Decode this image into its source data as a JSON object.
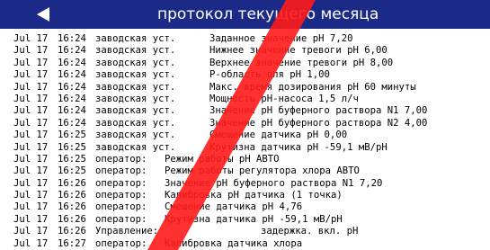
{
  "header": {
    "title": "протокол текущего месяца",
    "back_icon": "left-triangle-icon"
  },
  "colors": {
    "header_bg": "#1a2a86",
    "watermark": "#ff1a1a"
  },
  "log": [
    {
      "date": "Jul 17",
      "time": "16:24",
      "source": "заводская уст.",
      "message": "Заданное значение pH 7,20"
    },
    {
      "date": "Jul 17",
      "time": "16:24",
      "source": "заводская уст.",
      "message": "Нижнее значение тревоги pH 6,00"
    },
    {
      "date": "Jul 17",
      "time": "16:24",
      "source": "заводская уст.",
      "message": "Верхнее значение тревоги pH 8,00"
    },
    {
      "date": "Jul 17",
      "time": "16:24",
      "source": "заводская уст.",
      "message": "P-область для pH 1,00"
    },
    {
      "date": "Jul 17",
      "time": "16:24",
      "source": "заводская уст.",
      "message": "Макс. время дозирования pH 60 минуты"
    },
    {
      "date": "Jul 17",
      "time": "16:24",
      "source": "заводская уст.",
      "message": "Мощность pH-насоса 1,5 л/ч"
    },
    {
      "date": "Jul 17",
      "time": "16:24",
      "source": "заводская уст.",
      "message": "Значение pH буферного раствора N1 7,00"
    },
    {
      "date": "Jul 17",
      "time": "16:24",
      "source": "заводская уст.",
      "message": "Значение pH буферного раствора N2 4,00"
    },
    {
      "date": "Jul 17",
      "time": "16:25",
      "source": "заводская уст.",
      "message": "Смещение датчика pH 0,00"
    },
    {
      "date": "Jul 17",
      "time": "16:25",
      "source": "заводская уст.",
      "message": "Крутизна датчика pH -59,1 мВ/pH"
    },
    {
      "date": "Jul 17",
      "time": "16:25",
      "source": "оператор:",
      "message": "Режим работы pH АВТО"
    },
    {
      "date": "Jul 17",
      "time": "16:25",
      "source": "оператор:",
      "message": "Режим работы регулятора хлора АВТО"
    },
    {
      "date": "Jul 17",
      "time": "16:26",
      "source": "оператор:",
      "message": "Значение pH буферного раствора N1 7,20"
    },
    {
      "date": "Jul 17",
      "time": "16:26",
      "source": "оператор:",
      "message": "Калибровка pH датчика (1 точка)"
    },
    {
      "date": "Jul 17",
      "time": "16:26",
      "source": "оператор:",
      "message": "Смещение датчика pH 4,76"
    },
    {
      "date": "Jul 17",
      "time": "16:26",
      "source": "оператор:",
      "message": "Крутизна датчика pH -59,1 мВ/pH"
    },
    {
      "date": "Jul 17",
      "time": "16:26",
      "source": "Управление:",
      "message": "задержка. вкл. pH"
    },
    {
      "date": "Jul 17",
      "time": "16:27",
      "source": "оператор:",
      "message": "Калибровка датчика хлора"
    }
  ]
}
